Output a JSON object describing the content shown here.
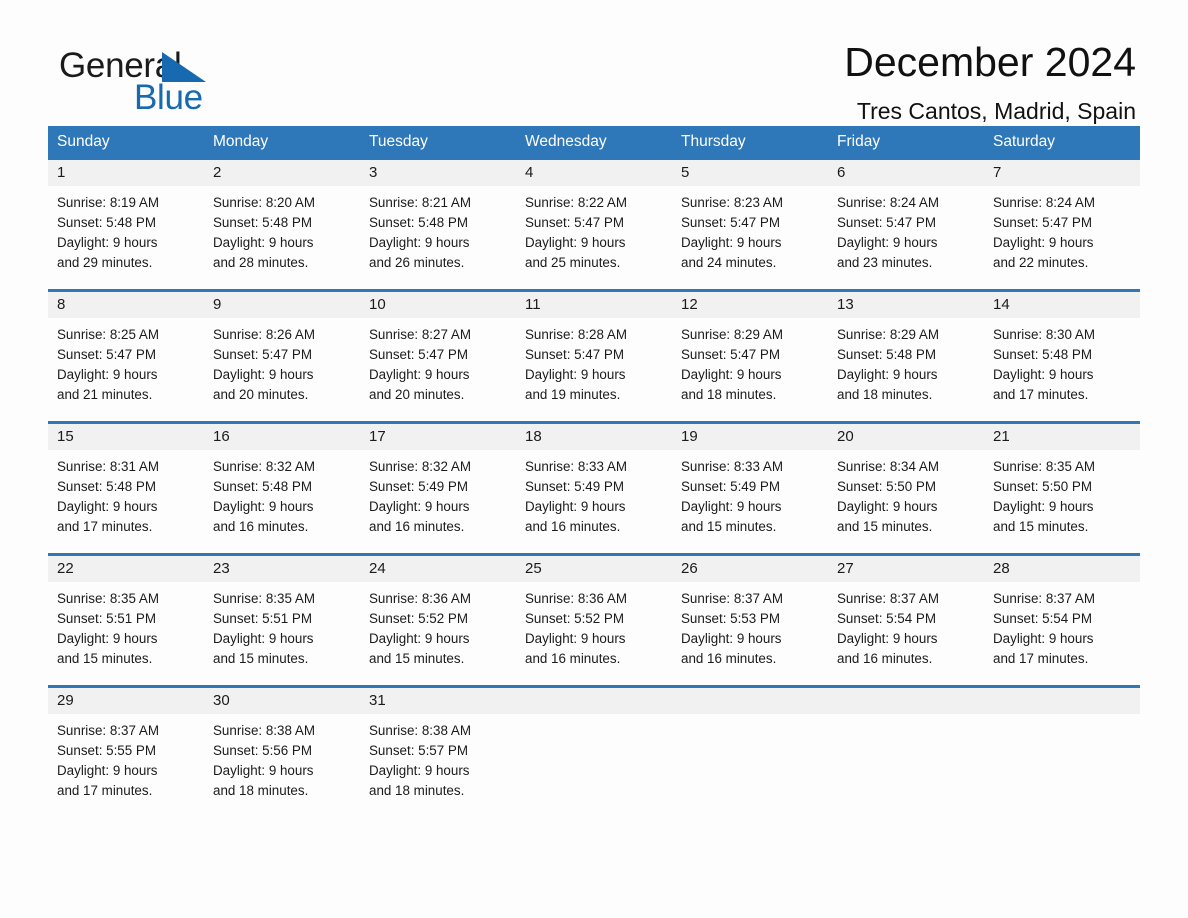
{
  "brand": {
    "name_part1": "General",
    "name_part2": "Blue",
    "flag_icon": "triangle-flag-icon",
    "accent_color": "#1769b0"
  },
  "header": {
    "month_title": "December 2024",
    "location": "Tres Cantos, Madrid, Spain"
  },
  "calendar": {
    "header_color": "#2e77b8",
    "weekdays": [
      "Sunday",
      "Monday",
      "Tuesday",
      "Wednesday",
      "Thursday",
      "Friday",
      "Saturday"
    ],
    "weeks": [
      [
        {
          "day": "1",
          "sunrise": "Sunrise: 8:19 AM",
          "sunset": "Sunset: 5:48 PM",
          "daylight_line1": "Daylight: 9 hours",
          "daylight_line2": "and 29 minutes."
        },
        {
          "day": "2",
          "sunrise": "Sunrise: 8:20 AM",
          "sunset": "Sunset: 5:48 PM",
          "daylight_line1": "Daylight: 9 hours",
          "daylight_line2": "and 28 minutes."
        },
        {
          "day": "3",
          "sunrise": "Sunrise: 8:21 AM",
          "sunset": "Sunset: 5:48 PM",
          "daylight_line1": "Daylight: 9 hours",
          "daylight_line2": "and 26 minutes."
        },
        {
          "day": "4",
          "sunrise": "Sunrise: 8:22 AM",
          "sunset": "Sunset: 5:47 PM",
          "daylight_line1": "Daylight: 9 hours",
          "daylight_line2": "and 25 minutes."
        },
        {
          "day": "5",
          "sunrise": "Sunrise: 8:23 AM",
          "sunset": "Sunset: 5:47 PM",
          "daylight_line1": "Daylight: 9 hours",
          "daylight_line2": "and 24 minutes."
        },
        {
          "day": "6",
          "sunrise": "Sunrise: 8:24 AM",
          "sunset": "Sunset: 5:47 PM",
          "daylight_line1": "Daylight: 9 hours",
          "daylight_line2": "and 23 minutes."
        },
        {
          "day": "7",
          "sunrise": "Sunrise: 8:24 AM",
          "sunset": "Sunset: 5:47 PM",
          "daylight_line1": "Daylight: 9 hours",
          "daylight_line2": "and 22 minutes."
        }
      ],
      [
        {
          "day": "8",
          "sunrise": "Sunrise: 8:25 AM",
          "sunset": "Sunset: 5:47 PM",
          "daylight_line1": "Daylight: 9 hours",
          "daylight_line2": "and 21 minutes."
        },
        {
          "day": "9",
          "sunrise": "Sunrise: 8:26 AM",
          "sunset": "Sunset: 5:47 PM",
          "daylight_line1": "Daylight: 9 hours",
          "daylight_line2": "and 20 minutes."
        },
        {
          "day": "10",
          "sunrise": "Sunrise: 8:27 AM",
          "sunset": "Sunset: 5:47 PM",
          "daylight_line1": "Daylight: 9 hours",
          "daylight_line2": "and 20 minutes."
        },
        {
          "day": "11",
          "sunrise": "Sunrise: 8:28 AM",
          "sunset": "Sunset: 5:47 PM",
          "daylight_line1": "Daylight: 9 hours",
          "daylight_line2": "and 19 minutes."
        },
        {
          "day": "12",
          "sunrise": "Sunrise: 8:29 AM",
          "sunset": "Sunset: 5:47 PM",
          "daylight_line1": "Daylight: 9 hours",
          "daylight_line2": "and 18 minutes."
        },
        {
          "day": "13",
          "sunrise": "Sunrise: 8:29 AM",
          "sunset": "Sunset: 5:48 PM",
          "daylight_line1": "Daylight: 9 hours",
          "daylight_line2": "and 18 minutes."
        },
        {
          "day": "14",
          "sunrise": "Sunrise: 8:30 AM",
          "sunset": "Sunset: 5:48 PM",
          "daylight_line1": "Daylight: 9 hours",
          "daylight_line2": "and 17 minutes."
        }
      ],
      [
        {
          "day": "15",
          "sunrise": "Sunrise: 8:31 AM",
          "sunset": "Sunset: 5:48 PM",
          "daylight_line1": "Daylight: 9 hours",
          "daylight_line2": "and 17 minutes."
        },
        {
          "day": "16",
          "sunrise": "Sunrise: 8:32 AM",
          "sunset": "Sunset: 5:48 PM",
          "daylight_line1": "Daylight: 9 hours",
          "daylight_line2": "and 16 minutes."
        },
        {
          "day": "17",
          "sunrise": "Sunrise: 8:32 AM",
          "sunset": "Sunset: 5:49 PM",
          "daylight_line1": "Daylight: 9 hours",
          "daylight_line2": "and 16 minutes."
        },
        {
          "day": "18",
          "sunrise": "Sunrise: 8:33 AM",
          "sunset": "Sunset: 5:49 PM",
          "daylight_line1": "Daylight: 9 hours",
          "daylight_line2": "and 16 minutes."
        },
        {
          "day": "19",
          "sunrise": "Sunrise: 8:33 AM",
          "sunset": "Sunset: 5:49 PM",
          "daylight_line1": "Daylight: 9 hours",
          "daylight_line2": "and 15 minutes."
        },
        {
          "day": "20",
          "sunrise": "Sunrise: 8:34 AM",
          "sunset": "Sunset: 5:50 PM",
          "daylight_line1": "Daylight: 9 hours",
          "daylight_line2": "and 15 minutes."
        },
        {
          "day": "21",
          "sunrise": "Sunrise: 8:35 AM",
          "sunset": "Sunset: 5:50 PM",
          "daylight_line1": "Daylight: 9 hours",
          "daylight_line2": "and 15 minutes."
        }
      ],
      [
        {
          "day": "22",
          "sunrise": "Sunrise: 8:35 AM",
          "sunset": "Sunset: 5:51 PM",
          "daylight_line1": "Daylight: 9 hours",
          "daylight_line2": "and 15 minutes."
        },
        {
          "day": "23",
          "sunrise": "Sunrise: 8:35 AM",
          "sunset": "Sunset: 5:51 PM",
          "daylight_line1": "Daylight: 9 hours",
          "daylight_line2": "and 15 minutes."
        },
        {
          "day": "24",
          "sunrise": "Sunrise: 8:36 AM",
          "sunset": "Sunset: 5:52 PM",
          "daylight_line1": "Daylight: 9 hours",
          "daylight_line2": "and 15 minutes."
        },
        {
          "day": "25",
          "sunrise": "Sunrise: 8:36 AM",
          "sunset": "Sunset: 5:52 PM",
          "daylight_line1": "Daylight: 9 hours",
          "daylight_line2": "and 16 minutes."
        },
        {
          "day": "26",
          "sunrise": "Sunrise: 8:37 AM",
          "sunset": "Sunset: 5:53 PM",
          "daylight_line1": "Daylight: 9 hours",
          "daylight_line2": "and 16 minutes."
        },
        {
          "day": "27",
          "sunrise": "Sunrise: 8:37 AM",
          "sunset": "Sunset: 5:54 PM",
          "daylight_line1": "Daylight: 9 hours",
          "daylight_line2": "and 16 minutes."
        },
        {
          "day": "28",
          "sunrise": "Sunrise: 8:37 AM",
          "sunset": "Sunset: 5:54 PM",
          "daylight_line1": "Daylight: 9 hours",
          "daylight_line2": "and 17 minutes."
        }
      ],
      [
        {
          "day": "29",
          "sunrise": "Sunrise: 8:37 AM",
          "sunset": "Sunset: 5:55 PM",
          "daylight_line1": "Daylight: 9 hours",
          "daylight_line2": "and 17 minutes."
        },
        {
          "day": "30",
          "sunrise": "Sunrise: 8:38 AM",
          "sunset": "Sunset: 5:56 PM",
          "daylight_line1": "Daylight: 9 hours",
          "daylight_line2": "and 18 minutes."
        },
        {
          "day": "31",
          "sunrise": "Sunrise: 8:38 AM",
          "sunset": "Sunset: 5:57 PM",
          "daylight_line1": "Daylight: 9 hours",
          "daylight_line2": "and 18 minutes."
        },
        {
          "day": "",
          "sunrise": "",
          "sunset": "",
          "daylight_line1": "",
          "daylight_line2": ""
        },
        {
          "day": "",
          "sunrise": "",
          "sunset": "",
          "daylight_line1": "",
          "daylight_line2": ""
        },
        {
          "day": "",
          "sunrise": "",
          "sunset": "",
          "daylight_line1": "",
          "daylight_line2": ""
        },
        {
          "day": "",
          "sunrise": "",
          "sunset": "",
          "daylight_line1": "",
          "daylight_line2": ""
        }
      ]
    ]
  }
}
